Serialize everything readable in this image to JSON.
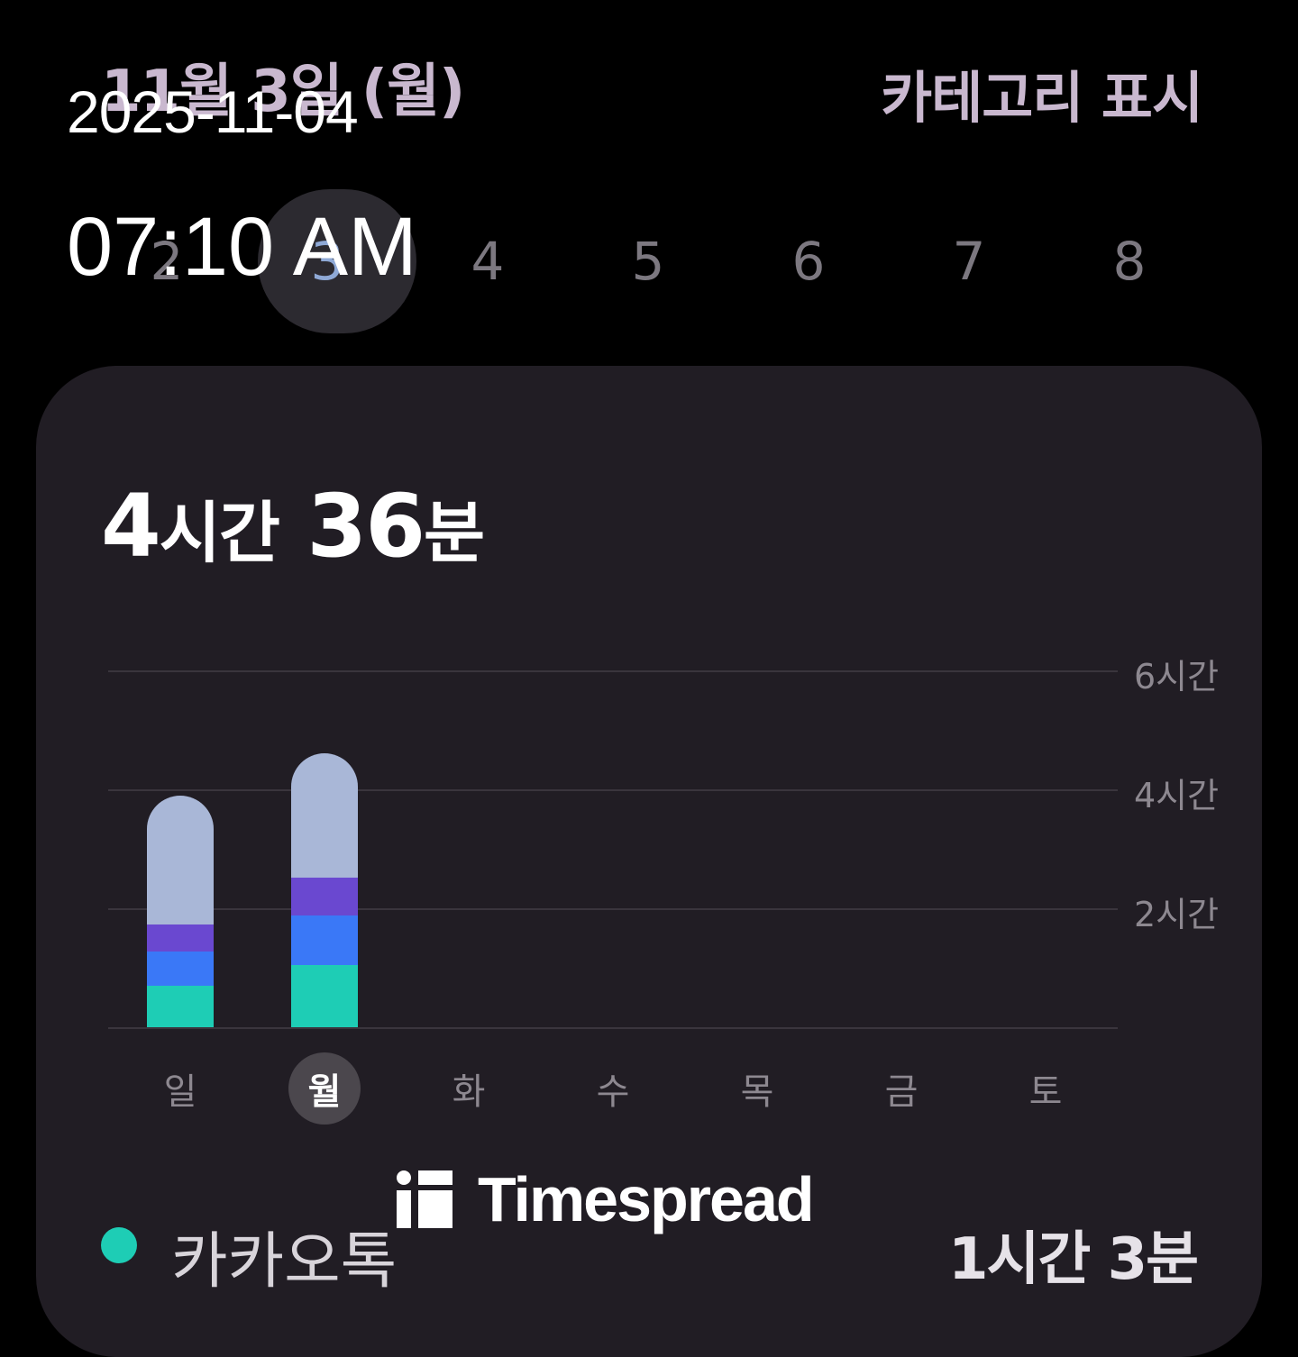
{
  "header": {
    "date_label": "11월 3일 (월)",
    "category_toggle": "카테고리 표시"
  },
  "overlay": {
    "date": "2025-11-04",
    "time": "07:10 AM"
  },
  "day_strip": {
    "days": [
      "2",
      "3",
      "4",
      "5",
      "6",
      "7",
      "8"
    ],
    "selected_index": 1
  },
  "summary": {
    "total_hours": "4",
    "hours_unit": "시간",
    "total_minutes": "36",
    "minutes_unit": "분"
  },
  "chart_data": {
    "type": "bar",
    "stacked": true,
    "categories": [
      "일",
      "월",
      "화",
      "수",
      "목",
      "금",
      "토"
    ],
    "selected_category": "월",
    "y_tick_labels": [
      "2시간",
      "4시간",
      "6시간"
    ],
    "y_ticks_minutes": [
      120,
      240,
      360
    ],
    "ylim_minutes": [
      0,
      360
    ],
    "grid": true,
    "series": [
      {
        "color": "#1ecdb5",
        "values": [
          42,
          63,
          0,
          0,
          0,
          0,
          0
        ]
      },
      {
        "color": "#3a78f7",
        "values": [
          34,
          50,
          0,
          0,
          0,
          0,
          0
        ]
      },
      {
        "color": "#6a48d0",
        "values": [
          28,
          38,
          0,
          0,
          0,
          0,
          0
        ]
      },
      {
        "color": "#a9b7d7",
        "values": [
          130,
          125,
          0,
          0,
          0,
          0,
          0
        ]
      }
    ]
  },
  "top_app": {
    "name": "카카오톡",
    "usage": "1시간 3분",
    "color": "#1ecdb5"
  },
  "watermark": {
    "text": "Timespread"
  }
}
